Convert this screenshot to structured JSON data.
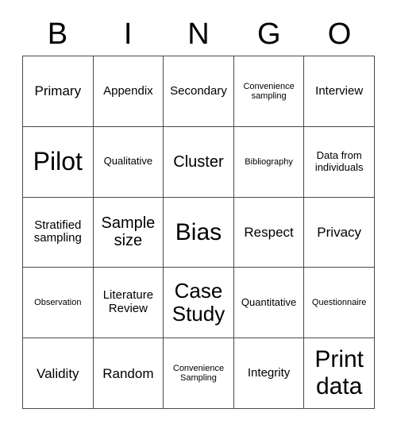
{
  "card": {
    "title": "BINGO",
    "header_letters": [
      "B",
      "I",
      "N",
      "G",
      "O"
    ],
    "grid_size": "5x5",
    "border_color": "#4a4a4a",
    "background_color": "#ffffff",
    "text_color": "#000000",
    "rows": [
      {
        "cells": [
          {
            "text": "Primary",
            "size": "lg"
          },
          {
            "text": "Appendix",
            "size": "md"
          },
          {
            "text": "Secondary",
            "size": "md"
          },
          {
            "text": "Convenience\nsampling",
            "size": "xs"
          },
          {
            "text": "Interview",
            "size": "md"
          }
        ]
      },
      {
        "cells": [
          {
            "text": "Pilot",
            "size": "4xl"
          },
          {
            "text": "Qualitative",
            "size": "sm"
          },
          {
            "text": "Cluster",
            "size": "xl"
          },
          {
            "text": "Bibliography",
            "size": "xs"
          },
          {
            "text": "Data from\nindividuals",
            "size": "sm"
          }
        ]
      },
      {
        "cells": [
          {
            "text": "Stratified\nsampling",
            "size": "md"
          },
          {
            "text": "Sample\nsize",
            "size": "xl"
          },
          {
            "text": "Bias",
            "size": "3xl"
          },
          {
            "text": "Respect",
            "size": "lg"
          },
          {
            "text": "Privacy",
            "size": "lg"
          }
        ]
      },
      {
        "cells": [
          {
            "text": "Observation",
            "size": "xs"
          },
          {
            "text": "Literature\nReview",
            "size": "md"
          },
          {
            "text": "Case\nStudy",
            "size": "2xl"
          },
          {
            "text": "Quantitative",
            "size": "sm"
          },
          {
            "text": "Questionnaire",
            "size": "xs"
          }
        ]
      },
      {
        "cells": [
          {
            "text": "Validity",
            "size": "lg"
          },
          {
            "text": "Random",
            "size": "lg"
          },
          {
            "text": "Convenience\nSampling",
            "size": "xs"
          },
          {
            "text": "Integrity",
            "size": "md"
          },
          {
            "text": "Print\ndata",
            "size": "3xl"
          }
        ]
      }
    ]
  }
}
